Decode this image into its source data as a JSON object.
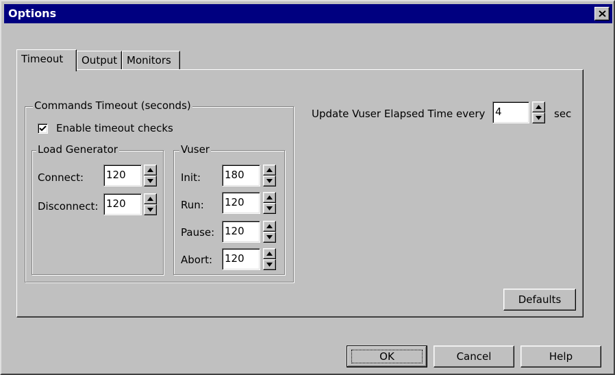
{
  "window": {
    "title": "Options",
    "close_glyph": "×"
  },
  "tabs": [
    {
      "label": "Timeout",
      "active": true
    },
    {
      "label": "Output",
      "active": false
    },
    {
      "label": "Monitors",
      "active": false
    }
  ],
  "commands_timeout": {
    "group_title": "Commands Timeout (seconds)",
    "enable_checkbox_label": "Enable timeout checks",
    "enable_checked": true,
    "load_generator": {
      "group_title": "Load Generator",
      "connect_label": "Connect:",
      "connect_value": "120",
      "disconnect_label": "Disconnect:",
      "disconnect_value": "120"
    },
    "vuser": {
      "group_title": "Vuser",
      "init_label": "Init:",
      "init_value": "180",
      "run_label": "Run:",
      "run_value": "120",
      "pause_label": "Pause:",
      "pause_value": "120",
      "abort_label": "Abort:",
      "abort_value": "120"
    }
  },
  "elapsed": {
    "label": "Update Vuser Elapsed Time every",
    "value": "4",
    "unit": "sec"
  },
  "buttons": {
    "defaults": "Defaults",
    "ok": "OK",
    "cancel": "Cancel",
    "help": "Help"
  },
  "icons": {
    "close": "close-icon",
    "spin_up": "spin-up-icon",
    "spin_down": "spin-down-icon",
    "check": "checkmark-icon"
  },
  "colors": {
    "titlebar": "#000080",
    "face": "#c0c0c0",
    "shadow": "#808080",
    "highlight": "#ffffff"
  }
}
